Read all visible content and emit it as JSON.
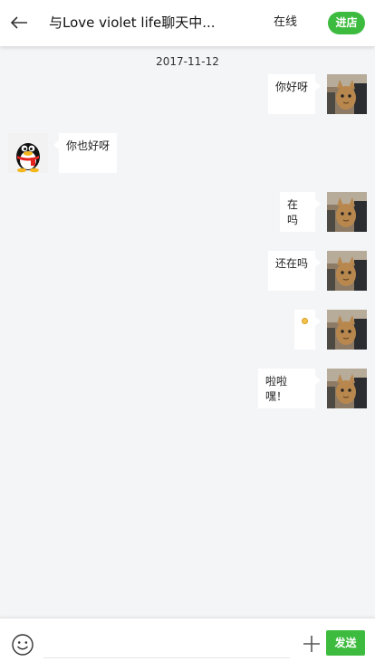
{
  "header": {
    "title": "与Love violet life聊天中...",
    "status": "在线",
    "shop_button": "进店"
  },
  "date_label": "2017-11-12",
  "messages": [
    {
      "side": "right",
      "text": "你好呀"
    },
    {
      "side": "left",
      "text": "你也好呀"
    },
    {
      "side": "right",
      "text": "在吗"
    },
    {
      "side": "right",
      "text": "还在吗"
    },
    {
      "side": "right",
      "emoji": "smiley-emoji"
    },
    {
      "side": "right",
      "text": "啦啦嘿！"
    }
  ],
  "footer": {
    "input_value": "",
    "send_button": "发送"
  },
  "icons": {
    "back": "back-arrow-icon",
    "emoji": "smiley-icon",
    "plus": "plus-icon"
  },
  "colors": {
    "accent_green": "#3dbb3f",
    "background": "#f4f5f7",
    "bubble": "#ffffff"
  }
}
